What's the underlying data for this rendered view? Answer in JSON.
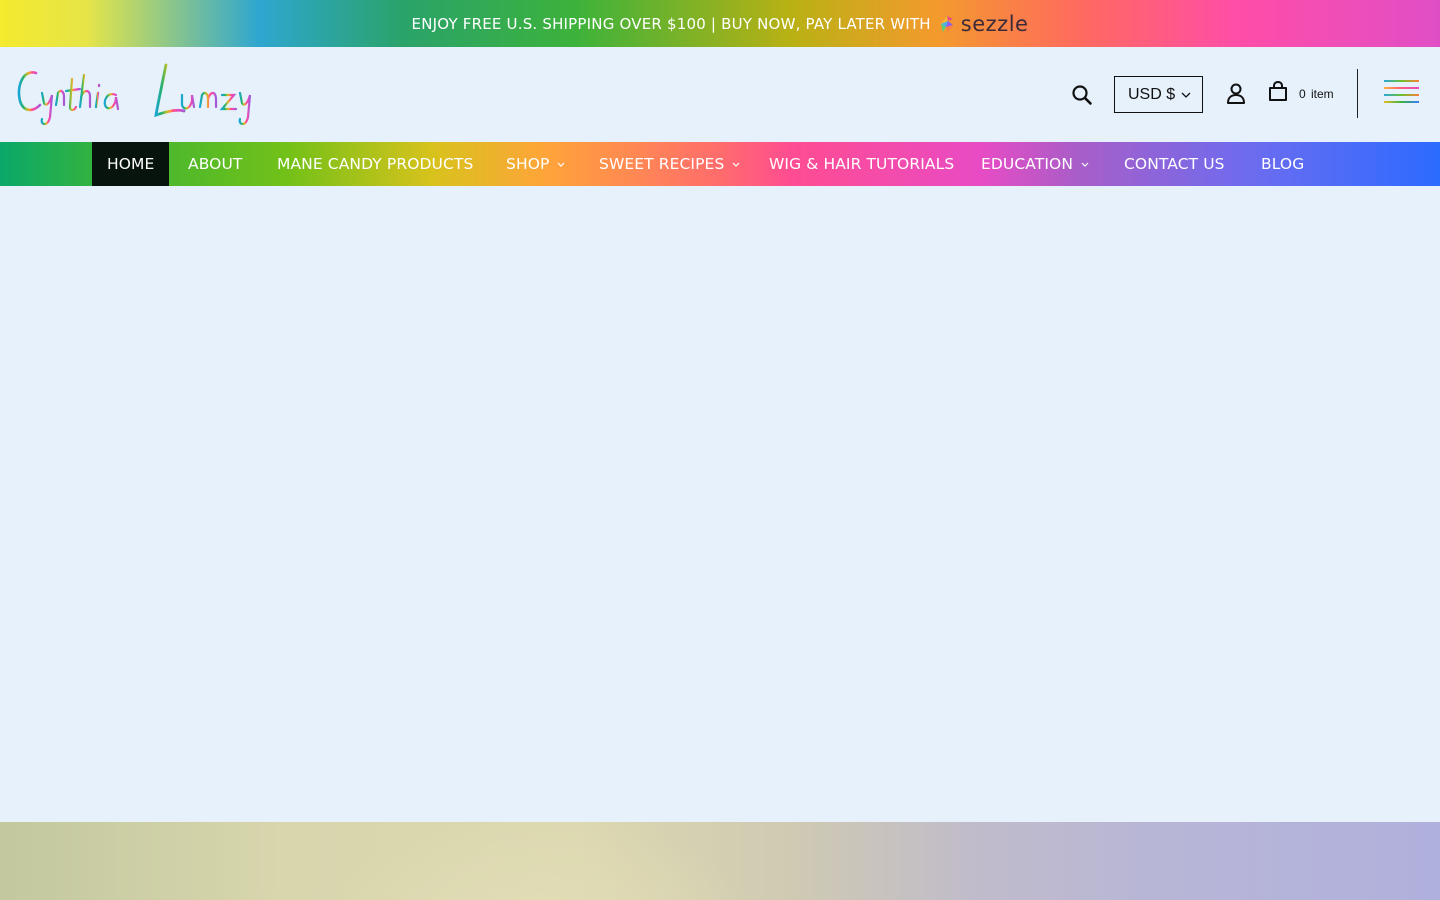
{
  "announcement": {
    "text": "ENJOY FREE U.S. SHIPPING OVER $100 | BUY NOW, PAY LATER WITH",
    "sezzle_label": "sezzle"
  },
  "header": {
    "logo_text": "Cynthia Lumzy",
    "currency": "USD $",
    "cart_count": "0",
    "cart_label": "item",
    "icons": {
      "search": "search-icon",
      "account": "account-icon",
      "cart": "cart-icon",
      "menu": "hamburger-menu-icon"
    }
  },
  "nav": {
    "items": [
      {
        "label": "HOME",
        "active": true,
        "has_dropdown": false
      },
      {
        "label": "ABOUT",
        "active": false,
        "has_dropdown": false
      },
      {
        "label": "MANE CANDY PRODUCTS",
        "active": false,
        "has_dropdown": false
      },
      {
        "label": "SHOP",
        "active": false,
        "has_dropdown": true
      },
      {
        "label": "SWEET RECIPES",
        "active": false,
        "has_dropdown": true
      },
      {
        "label": "WIG & HAIR TUTORIALS",
        "active": false,
        "has_dropdown": false
      },
      {
        "label": "EDUCATION",
        "active": false,
        "has_dropdown": true
      },
      {
        "label": "CONTACT US",
        "active": false,
        "has_dropdown": false
      },
      {
        "label": "BLOG",
        "active": false,
        "has_dropdown": false
      }
    ]
  },
  "colors": {
    "page_background": "#e6f1fb",
    "nav_active_background": "#06140d",
    "nav_text": "#ffffff"
  }
}
